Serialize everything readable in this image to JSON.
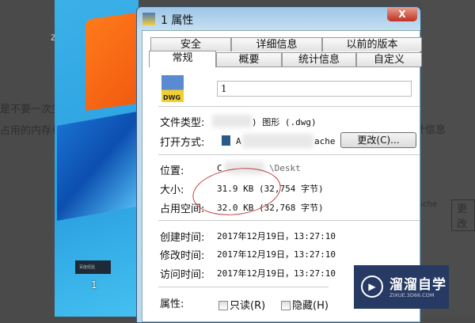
{
  "background": {
    "left_texts": [
      "z",
      "是不要一次生",
      "占用的内存也"
    ],
    "right_texts": [
      "计信息",
      "ache",
      "更改"
    ]
  },
  "desktop": {
    "file_label": "1",
    "thumb_text": "百度经验"
  },
  "dialog": {
    "title": "1 属性",
    "close": "X",
    "file_icon_text": "DWG",
    "tabs_row1": [
      "安全",
      "详细信息",
      "以前的版本"
    ],
    "tabs_row2": [
      "常规",
      "概要",
      "统计信息",
      "自定义"
    ],
    "active_tab": "常规",
    "filename": "1",
    "file_type_label": "文件类型:",
    "file_type_value": ") 图形 (.dwg)",
    "open_with_label": "打开方式:",
    "open_with_value_start": "A",
    "open_with_value_end": "ache",
    "change_button": "更改(C)...",
    "location_label": "位置:",
    "location_value_start": "C",
    "location_value_end": "\\Deskt",
    "size_label": "大小:",
    "size_value": "31.9 KB (32,754 字节)",
    "disk_size_label": "占用空间:",
    "disk_size_value": "32.0 KB (32,768 字节)",
    "created_label": "创建时间:",
    "created_value": "2017年12月19日，13:27:10",
    "modified_label": "修改时间:",
    "modified_value": "2017年12月19日，13:27:10",
    "accessed_label": "访问时间:",
    "accessed_value": "2017年12月19日，13:27:10",
    "attributes_label": "属性:",
    "readonly": "只读(R)",
    "hidden": "隐藏(H)"
  },
  "watermark": {
    "name": "溜溜自学",
    "url": "ZIXUE.3D66.COM"
  }
}
